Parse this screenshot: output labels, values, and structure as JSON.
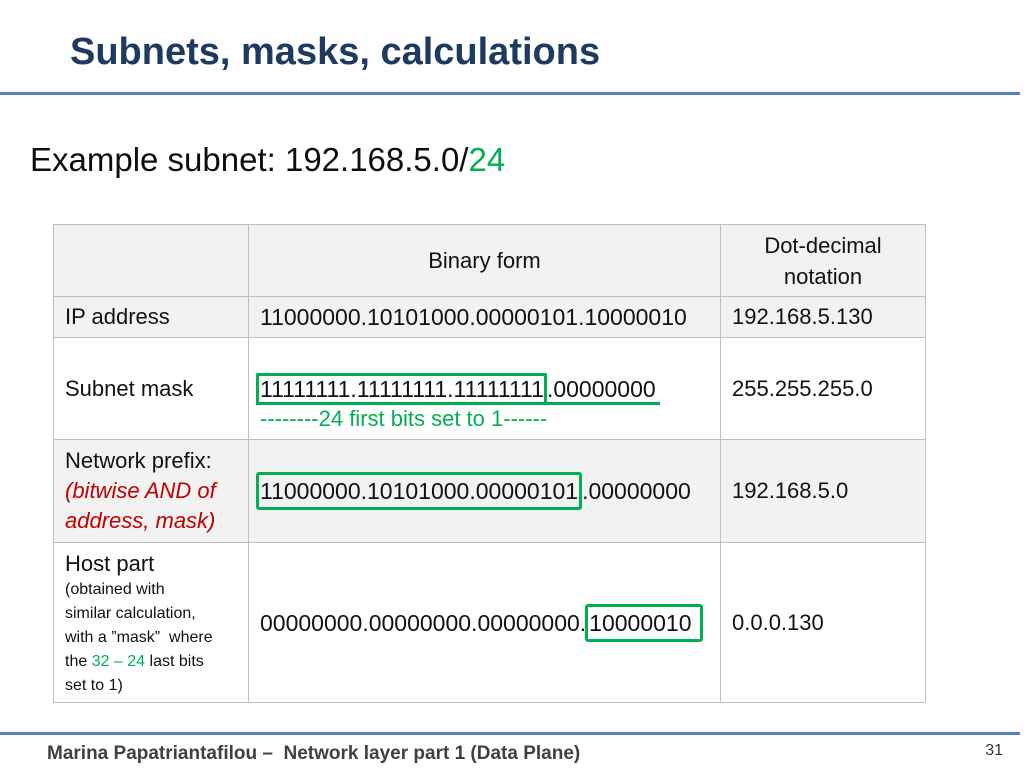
{
  "slide": {
    "title": "Subnets, masks, calculations",
    "page_number": "31"
  },
  "example": {
    "text": "Example subnet: 192.168.5.0/",
    "prefix_length": "24"
  },
  "table": {
    "header": {
      "binary": "Binary form",
      "dotted": "Dot-decimal notation"
    },
    "ip_address": {
      "label": "IP address",
      "binary": "11000000.10101000.00000101.10000010",
      "dotted": "192.168.5.130"
    },
    "subnet_mask": {
      "label": "Subnet mask",
      "binary_highlighted": "11111111.11111111.11111111",
      "binary_rest": ".00000000",
      "note": "--------24 first bits set to 1------",
      "dotted": "255.255.255.0"
    },
    "network_prefix": {
      "label": "Network prefix:",
      "note_lines": [
        "(bitwise AND of",
        "address, mask)"
      ],
      "binary_highlighted": "11000000.10101000.00000101",
      "binary_rest": ".00000000",
      "dotted": "192.168.5.0"
    },
    "host_part": {
      "label": "Host part",
      "note_lines": [
        "(obtained with",
        "similar calculation,",
        "with a ”mask”  where"
      ],
      "note_line_4": {
        "before": "the ",
        "highlight": "32 – 24",
        "after": " last bits"
      },
      "note_last": "set to 1)",
      "binary_lead": "00000000.00000000.00000000.",
      "binary_highlighted": "10000010",
      "dotted": "0.0.0.130"
    }
  },
  "footer": {
    "text": "Marina Papatriantafilou –  Network layer part 1 (Data Plane)"
  },
  "colors": {
    "title": "#1f3a60",
    "rule": "#5581bb",
    "highlight_green": "#00b050",
    "highlight_red": "#c00000",
    "table_border": "#bfbfbf",
    "band_fill": "#f2f2f2"
  }
}
